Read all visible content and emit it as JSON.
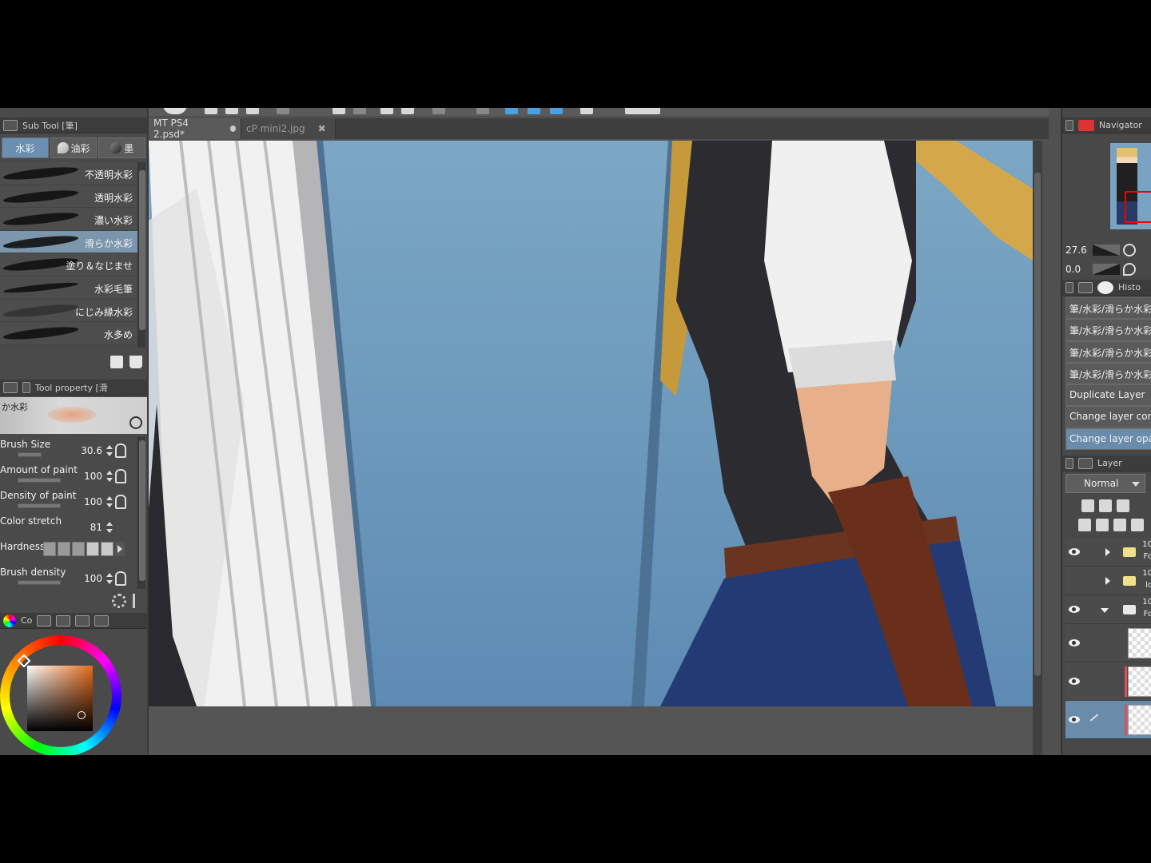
{
  "left_panel": {
    "subtool_header": "Sub Tool [筆]",
    "subtool_tabs": [
      "水彩",
      "油彩",
      "墨"
    ],
    "brushes": [
      "不透明水彩",
      "透明水彩",
      "濃い水彩",
      "滑らか水彩",
      "塗り＆なじませ",
      "水彩毛筆",
      "にじみ縁水彩",
      "水多め"
    ],
    "selected_brush_index": 3,
    "tool_property_header": "Tool property [滑",
    "preview_label": "か水彩",
    "properties": [
      {
        "label": "Brush Size",
        "value": "30.6"
      },
      {
        "label": "Amount of paint",
        "value": "100"
      },
      {
        "label": "Density of paint",
        "value": "100"
      },
      {
        "label": "Color stretch",
        "value": "81"
      },
      {
        "label": "Hardness",
        "value": ""
      },
      {
        "label": "Brush density",
        "value": "100"
      }
    ],
    "color_header": "Co",
    "colors": {
      "main": "#e66a1a"
    }
  },
  "doc_tabs": [
    {
      "label": "MT PS4 2.psd*"
    },
    {
      "label": "cP mini2.jpg"
    }
  ],
  "right_panel": {
    "navigator_header": "Navigator",
    "zoom": "27.6",
    "rotation": "0.0",
    "history_header": "Histo",
    "history": [
      "筆/水彩/滑らか水彩",
      "筆/水彩/滑らか水彩",
      "筆/水彩/滑らか水彩",
      "筆/水彩/滑らか水彩",
      "Duplicate Layer",
      "Change layer com",
      "Change layer opac"
    ],
    "layer_header": "Layer",
    "blend_mode": "Normal",
    "layers": [
      {
        "opacity": "10",
        "name": "Fo"
      },
      {
        "opacity": "10",
        "name": "lo"
      },
      {
        "opacity": "10",
        "name": "Fo"
      }
    ]
  }
}
